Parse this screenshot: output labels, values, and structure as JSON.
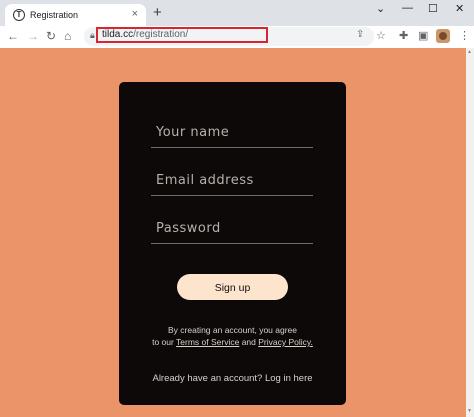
{
  "browser": {
    "tab_title": "Registration",
    "tab_favicon": "T",
    "tab_close": "×",
    "new_tab": "+",
    "url_host": "tilda.cc",
    "url_path": "/registration/",
    "window": {
      "minimize": "⌄",
      "min": "—",
      "max": "☐",
      "close": "✕"
    }
  },
  "form": {
    "name_placeholder": "Your name",
    "email_placeholder": "Email address",
    "password_placeholder": "Password",
    "signup_label": "Sign up",
    "terms_line1": "By creating an account, you agree",
    "terms_prefix": "to our ",
    "terms_link": "Terms of Service",
    "terms_and": " and ",
    "privacy_link": "Privacy Policy.",
    "login_text": "Already have an account? Log in here"
  },
  "colors": {
    "page_bg": "#eb946a",
    "panel_bg": "#0c0908",
    "button_bg": "#fde4cc",
    "url_highlight": "#d7262f"
  }
}
